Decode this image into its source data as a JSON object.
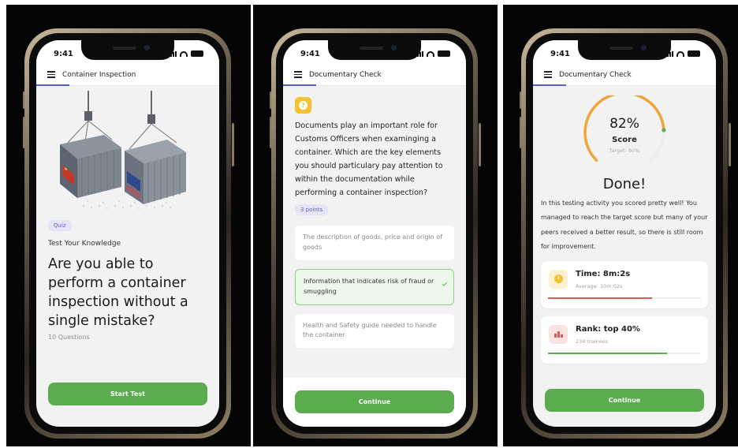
{
  "screen1": {
    "time": "9:41",
    "header_title": "Container Inspection",
    "tag": "Quiz",
    "subtitle": "Test Your Knowledge",
    "headline": "Are you able to perform a container inspection without a single mistake?",
    "questions": "10 Questions",
    "button": "Start Test"
  },
  "screen2": {
    "time": "9:41",
    "header_title": "Documentary Check",
    "question_icon": "question-badge-icon",
    "question": "Documents play an important role for Customs Officers when examinging a container. Which are the key elements you should particulary pay attention to within the documentation while performing a container inspection?",
    "points": "3 points",
    "options": [
      {
        "label": "The description of goods, price and origin of goods",
        "selected": false
      },
      {
        "label": "Information that indicates risk of fraud or smuggling",
        "selected": true
      },
      {
        "label": "Health and Safety guide needed to handle the container",
        "selected": false
      }
    ],
    "button": "Continue"
  },
  "screen3": {
    "time": "9:41",
    "header_title": "Documentary Check",
    "score_value": "82%",
    "score_label": "Score",
    "score_fraction": 0.82,
    "target": "Target: 80%",
    "done": "Done!",
    "body": "In this testing activity you scored pretty well! You managed to reach the target score but many of your peers received a better result, so there is still room for improvement.",
    "time_title": "Time: 8m:2s",
    "time_sub": "Average: 10m:02s",
    "time_fraction": 0.68,
    "rank_title": "Rank: top 40%",
    "rank_sub": "234 trainees",
    "rank_fraction": 0.78,
    "button": "Continue"
  },
  "colors": {
    "accent_green": "#5bab4f",
    "accent_purple": "#5b5fc7",
    "gauge_orange": "#f0a43c",
    "time_bar_red": "#e2574c",
    "rank_bar_green": "#5bab4f"
  }
}
